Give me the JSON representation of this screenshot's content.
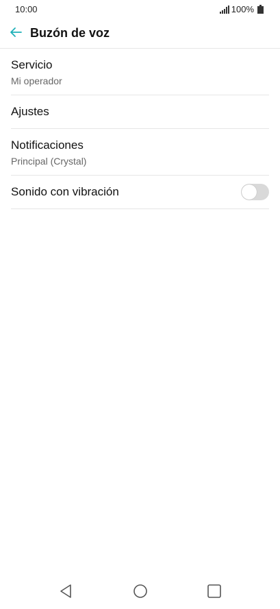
{
  "status_bar": {
    "time": "10:00",
    "battery_text": "100%",
    "signal_icon": "signal-icon",
    "battery_icon": "battery-icon"
  },
  "header": {
    "title": "Buzón de voz",
    "back_icon": "arrow-left-icon",
    "accent_color": "#1fb0b8"
  },
  "settings": {
    "items": [
      {
        "title": "Servicio",
        "subtitle": "Mi operador"
      },
      {
        "title": "Ajustes"
      },
      {
        "title": "Notificaciones",
        "subtitle": "Principal (Crystal)"
      },
      {
        "title": "Sonido con vibración",
        "toggle_on": false
      }
    ]
  },
  "nav_bar": {
    "back_icon": "triangle-back-icon",
    "home_icon": "circle-home-icon",
    "recents_icon": "square-recents-icon"
  }
}
